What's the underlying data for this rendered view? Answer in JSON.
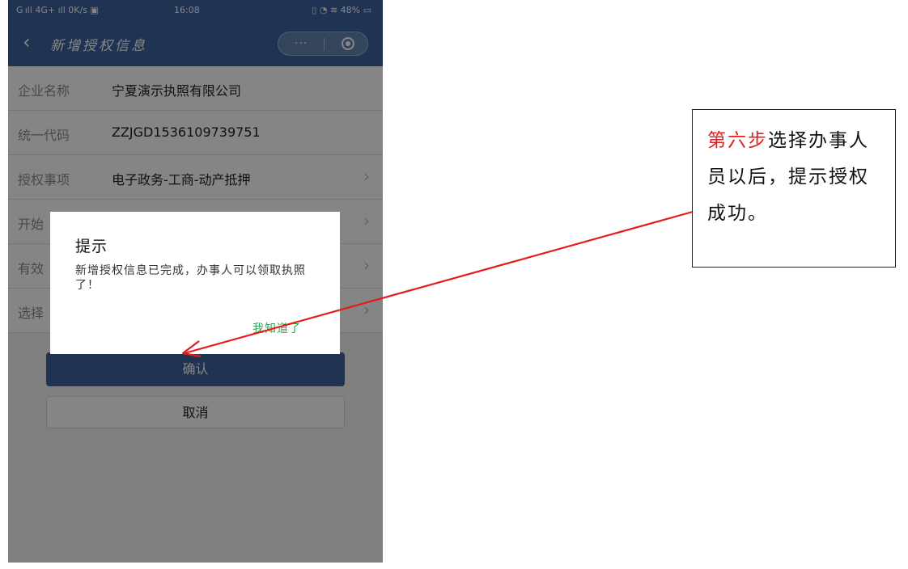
{
  "status_bar": {
    "left": "G ıll 4G+ ıll 0K/s ▣",
    "time": "16:08",
    "right": "▯ ◔ ≋ 48% ▭"
  },
  "nav": {
    "back_icon": "‹",
    "title": "新增授权信息",
    "more_icon": "···",
    "close_icon": "target-circle"
  },
  "form": {
    "rows": [
      {
        "label": "企业名称",
        "value": "宁夏演示执照有限公司",
        "chevron": ""
      },
      {
        "label": "统一代码",
        "value": "ZZJGD1536109739751",
        "chevron": ""
      },
      {
        "label": "授权事项",
        "value": "电子政务-工商-动产抵押",
        "chevron": "›"
      },
      {
        "label": "开始",
        "value": "",
        "chevron": "›"
      },
      {
        "label": "有效",
        "value": "",
        "chevron": "›"
      },
      {
        "label": "选择",
        "value": "",
        "chevron": "›"
      }
    ]
  },
  "buttons": {
    "confirm": "确认",
    "cancel": "取消"
  },
  "dialog": {
    "title": "提示",
    "message": "新增授权信息已完成，办事人可以领取执照了！",
    "ok": "我知道了"
  },
  "annotation": {
    "step": "第六步",
    "text": "选择办事人员以后，提示授权成功。"
  },
  "colors": {
    "nav": "#3f63a0",
    "ok_text": "#23b04a",
    "arrow": "#e81a1a",
    "step_text": "#e02020"
  }
}
